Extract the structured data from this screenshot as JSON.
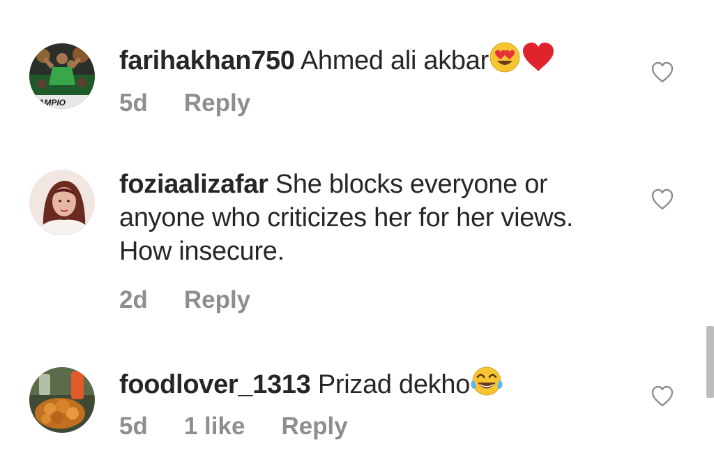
{
  "comments": [
    {
      "username": "farihakhan750",
      "text": " Ahmed ali akbar",
      "emojis": [
        "heart-eyes-emoji",
        "red-heart-emoji"
      ],
      "avatar_text": "HAMPIO",
      "meta": {
        "time": "5d",
        "likes": "",
        "reply": "Reply"
      }
    },
    {
      "username": "foziaalizafar",
      "text": " She blocks everyone or anyone who criticizes her for her views. How insecure.",
      "emojis": [],
      "meta": {
        "time": "2d",
        "likes": "",
        "reply": "Reply"
      }
    },
    {
      "username": "foodlover_1313",
      "text": " Prizad dekho",
      "emojis": [
        "tears-of-joy-emoji"
      ],
      "meta": {
        "time": "5d",
        "likes": "1 like",
        "reply": "Reply"
      }
    }
  ],
  "colors": {
    "text": "#262626",
    "meta": "#8e8e8e",
    "heart_outline": "#8e8e8e",
    "scrollbar": "#bdbdbd"
  },
  "icons": {
    "like": "heart-outline-icon"
  }
}
